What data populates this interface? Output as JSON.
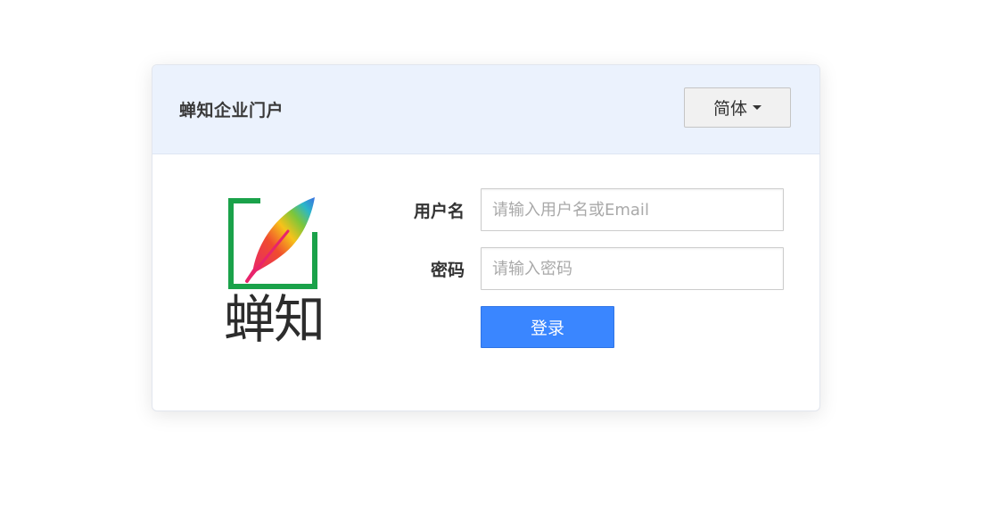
{
  "header": {
    "title": "蝉知企业门户",
    "language_button": "简体",
    "language_caret_icon": "caret-down-icon"
  },
  "logo": {
    "text": "蝉知",
    "icon": "feather-quill-icon",
    "frame_color": "#1aa24a"
  },
  "login_form": {
    "username_label": "用户名",
    "username_placeholder": "请输入用户名或Email",
    "username_value": "",
    "password_label": "密码",
    "password_placeholder": "请输入密码",
    "password_value": "",
    "submit_label": "登录"
  },
  "colors": {
    "header_bg": "#ebf2fd",
    "primary_button": "#3a86ff"
  }
}
